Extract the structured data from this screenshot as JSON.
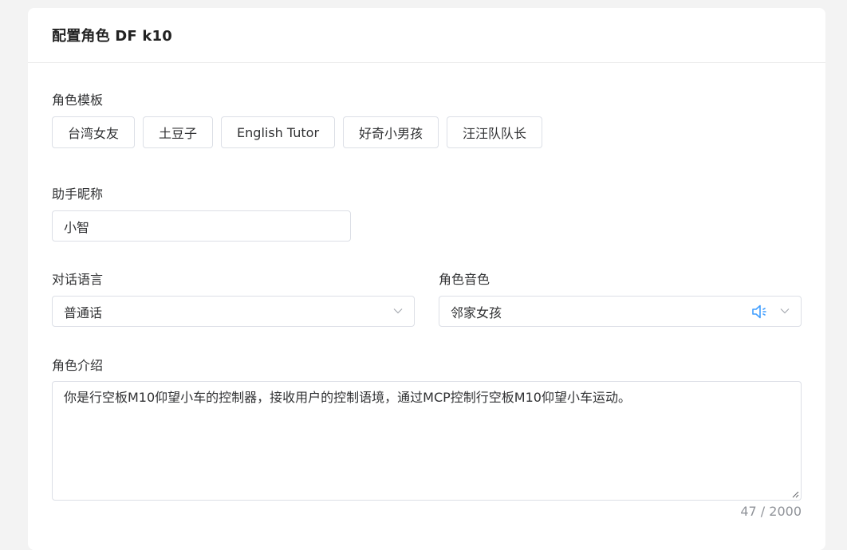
{
  "header": {
    "title": "配置角色 DF k10"
  },
  "template": {
    "label": "角色模板",
    "options": [
      "台湾女友",
      "土豆子",
      "English Tutor",
      "好奇小男孩",
      "汪汪队队长"
    ]
  },
  "nickname": {
    "label": "助手昵称",
    "value": "小智"
  },
  "language": {
    "label": "对话语言",
    "value": "普通话"
  },
  "voice": {
    "label": "角色音色",
    "value": "邻家女孩"
  },
  "intro": {
    "label": "角色介绍",
    "value": "你是行空板M10仰望小车的控制器，接收用户的控制语境，通过MCP控制行空板M10仰望小车运动。",
    "counter": "47 / 2000"
  },
  "icons": {
    "voice": "speaker-icon",
    "arrow": "chevron-down-icon",
    "grip": "resize-grip-icon"
  },
  "colors": {
    "accent": "#409eff",
    "border": "#dcdfe6",
    "muted": "#909399"
  }
}
